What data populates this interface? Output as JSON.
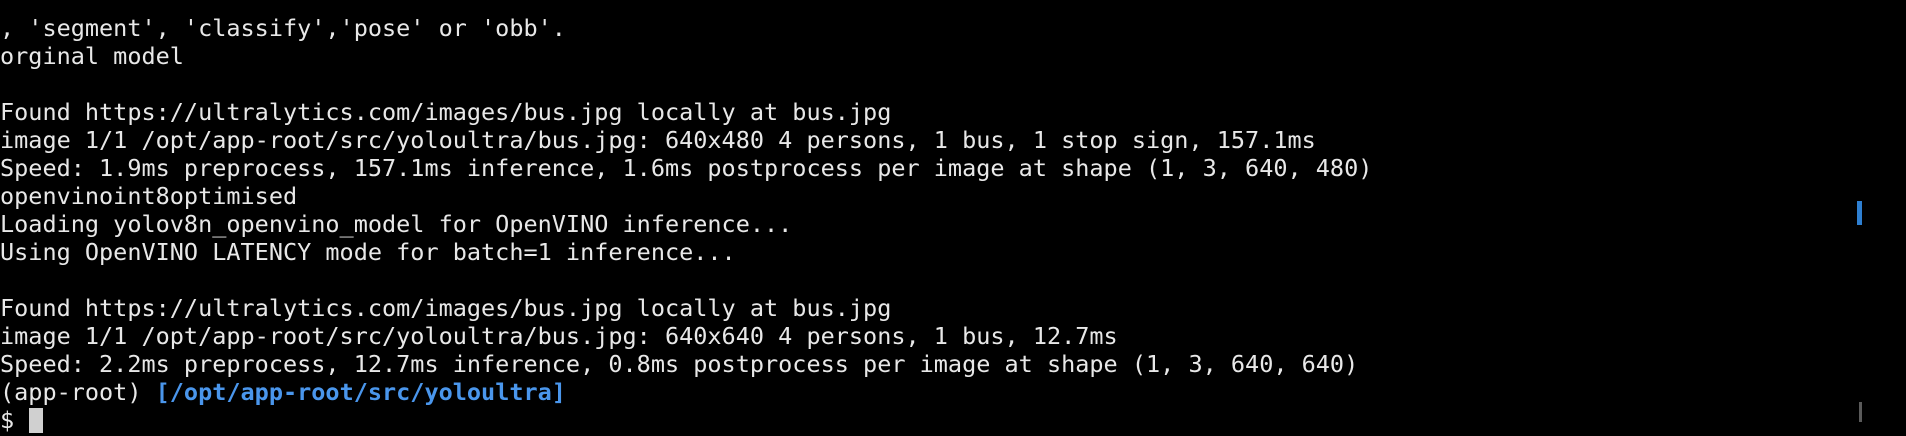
{
  "terminal": {
    "lines": [
      "  ",
      ", 'segment', 'classify','pose' or 'obb'.",
      "orginal model",
      "",
      "Found https://ultralytics.com/images/bus.jpg locally at bus.jpg",
      "image 1/1 /opt/app-root/src/yoloultra/bus.jpg: 640x480 4 persons, 1 bus, 1 stop sign, 157.1ms",
      "Speed: 1.9ms preprocess, 157.1ms inference, 1.6ms postprocess per image at shape (1, 3, 640, 480)",
      "openvinoint8optimised",
      "Loading yolov8n_openvino_model for OpenVINO inference...",
      "Using OpenVINO LATENCY mode for batch=1 inference...",
      "",
      "Found https://ultralytics.com/images/bus.jpg locally at bus.jpg",
      "image 1/1 /opt/app-root/src/yoloultra/bus.jpg: 640x640 4 persons, 1 bus, 12.7ms",
      "Speed: 2.2ms preprocess, 12.7ms inference, 0.8ms postprocess per image at shape (1, 3, 640, 640)"
    ],
    "prompt": {
      "env": "(app-root) ",
      "path": "[/opt/app-root/src/yoloultra]",
      "symbol": "$"
    }
  }
}
